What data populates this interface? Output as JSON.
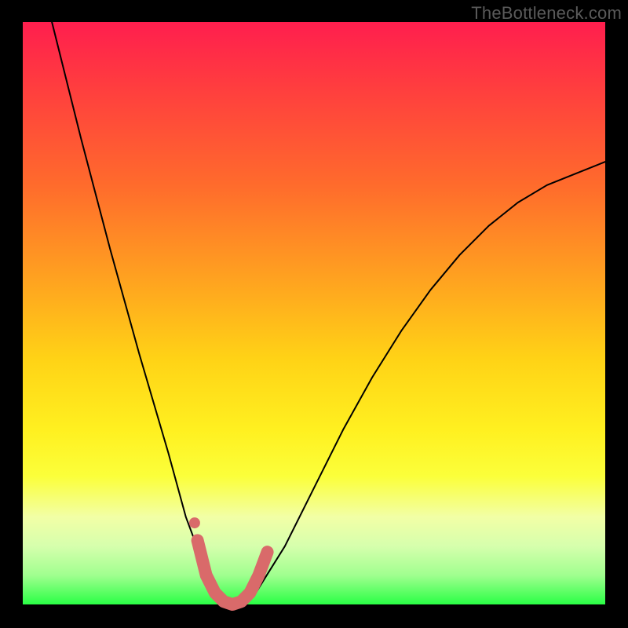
{
  "watermark": "TheBottleneck.com",
  "chart_data": {
    "type": "line",
    "title": "",
    "xlabel": "",
    "ylabel": "",
    "xlim": [
      0,
      100
    ],
    "ylim": [
      0,
      100
    ],
    "series": [
      {
        "name": "bottleneck-curve",
        "x": [
          5,
          10,
          15,
          20,
          25,
          28,
          31,
          33,
          35,
          37,
          40,
          45,
          50,
          55,
          60,
          65,
          70,
          75,
          80,
          85,
          90,
          95,
          100
        ],
        "values": [
          100,
          80,
          61,
          43,
          26,
          15,
          7,
          2,
          0,
          0,
          2,
          10,
          20,
          30,
          39,
          47,
          54,
          60,
          65,
          69,
          72,
          74,
          76
        ]
      }
    ],
    "markers": {
      "name": "highlight-markers",
      "color": "#d96a6a",
      "x": [
        30,
        31.5,
        33,
        34.5,
        36,
        37.5,
        39,
        40.5,
        42
      ],
      "values": [
        11,
        5,
        2,
        0.5,
        0,
        0.5,
        2,
        5,
        9
      ]
    },
    "annotations": []
  }
}
